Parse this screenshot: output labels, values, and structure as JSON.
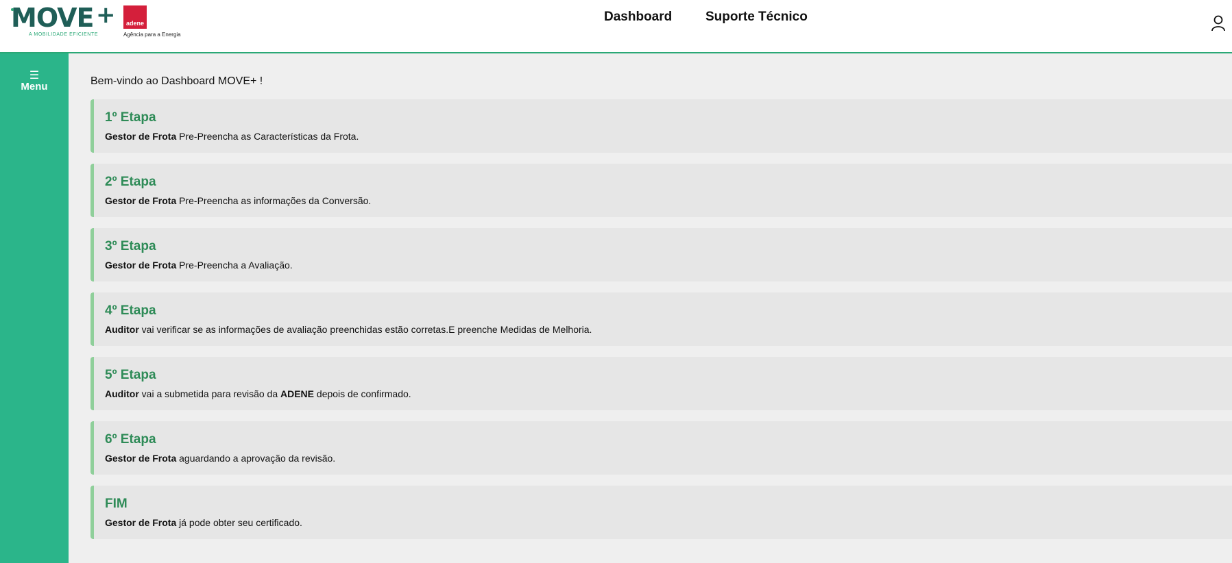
{
  "header": {
    "logo_move": {
      "word": "MOVE",
      "plus": "+",
      "tagline": "A MOBILIDADE EFICIENTE"
    },
    "logo_adene": {
      "box_text": "adene",
      "subtitle": "Agência para a Energia"
    },
    "nav": {
      "dashboard": "Dashboard",
      "support": "Suporte Técnico"
    },
    "user_icon": "user-icon"
  },
  "sidebar": {
    "menu_icon": "☰",
    "menu_label": "Menu"
  },
  "main": {
    "welcome": "Bem-vindo ao Dashboard MOVE+ !",
    "steps": [
      {
        "title": "1º Etapa",
        "parts": [
          {
            "b": "Gestor de Frota"
          },
          {
            "t": " Pre-Preencha as Características da Frota."
          }
        ]
      },
      {
        "title": "2º Etapa",
        "parts": [
          {
            "b": "Gestor de Frota"
          },
          {
            "t": " Pre-Preencha as informações da Conversão."
          }
        ]
      },
      {
        "title": "3º Etapa",
        "parts": [
          {
            "b": "Gestor de Frota"
          },
          {
            "t": " Pre-Preencha a Avaliação."
          }
        ]
      },
      {
        "title": "4º Etapa",
        "parts": [
          {
            "b": "Auditor"
          },
          {
            "t": " vai verificar se as informações de avaliação preenchidas estão corretas.E preenche Medidas de Melhoria."
          }
        ]
      },
      {
        "title": "5º Etapa",
        "parts": [
          {
            "b": "Auditor"
          },
          {
            "t": " vai a submetida para revisão da "
          },
          {
            "b": "ADENE"
          },
          {
            "t": " depois de confirmado."
          }
        ]
      },
      {
        "title": "6º Etapa",
        "parts": [
          {
            "b": "Gestor de Frota"
          },
          {
            "t": " aguardando a aprovação da revisão."
          }
        ]
      },
      {
        "title": "FIM",
        "parts": [
          {
            "b": "Gestor de Frota"
          },
          {
            "t": " já pode obter seu certificado."
          }
        ]
      }
    ]
  },
  "colors": {
    "accent": "#2bb58a",
    "step_title": "#2e8b57",
    "step_border": "#8fcf9a",
    "adene_red": "#d41f3b"
  }
}
